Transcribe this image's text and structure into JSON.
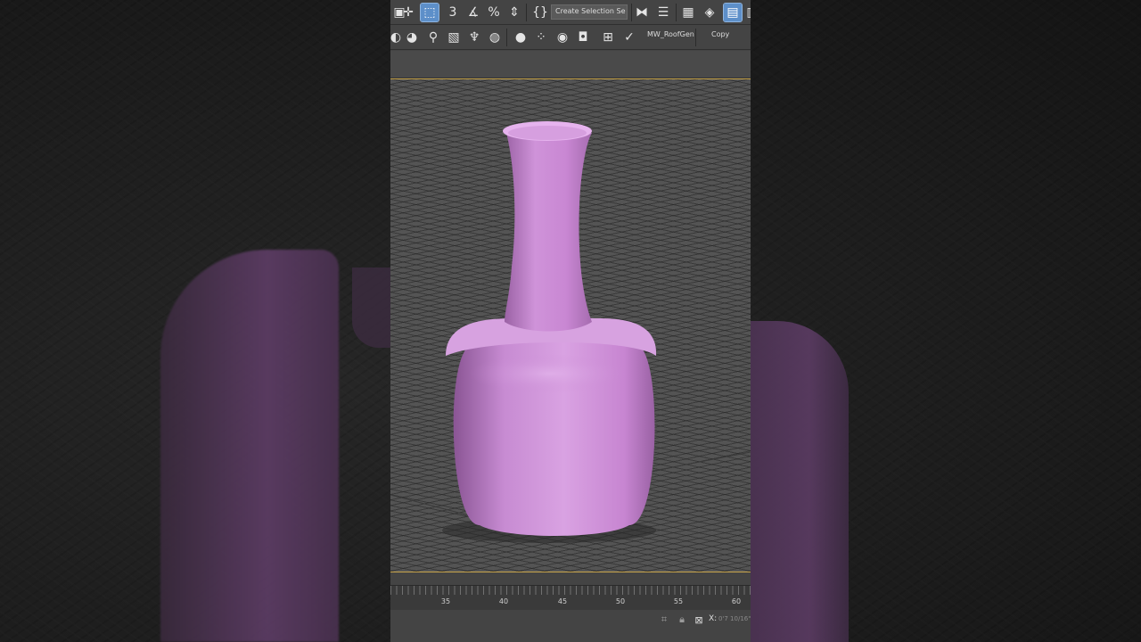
{
  "toolbar_top": {
    "selection_set_dropdown": "Create Selection Se",
    "icons": [
      "select-move-icon",
      "select-object-icon",
      "snap-3d-icon",
      "angle-snap-icon",
      "percent-snap-icon",
      "spinner-snap-icon",
      "named-selection-icon",
      "mirror-icon",
      "align-icon",
      "scene-explorer-icon",
      "layer-explorer-icon",
      "ribbon-toggle-icon"
    ]
  },
  "toolbar_second": {
    "script_button": "MW_RoofGen",
    "copy_button": "Copy",
    "icons": [
      "curve-editor-icon",
      "schematic-icon",
      "material-editor-icon",
      "render-setup-icon",
      "render-frame-icon",
      "render-icon",
      "light-icon",
      "environment-icon",
      "material-sphere-icon",
      "material-browser-icon",
      "vray-icon"
    ]
  },
  "timeline": {
    "tick_labels": [
      "35",
      "40",
      "45",
      "50",
      "55",
      "60"
    ]
  },
  "statusbar": {
    "x_label": "X:",
    "x_value": "0'7 10/16\""
  },
  "colors": {
    "vase_main": "#c98ad4",
    "vase_highlight": "#e2b4ea",
    "vase_shadow": "#7f4e88",
    "viewport_bg": "#545454",
    "viewport_border": "#c8a44a",
    "active_tool": "#5d8fc9"
  }
}
